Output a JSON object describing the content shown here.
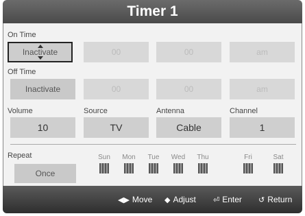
{
  "title": "Timer 1",
  "on_time": {
    "label": "On Time",
    "state": "Inactivate",
    "hour": "00",
    "minute": "00",
    "ampm": "am"
  },
  "off_time": {
    "label": "Off Time",
    "state": "Inactivate",
    "hour": "00",
    "minute": "00",
    "ampm": "am"
  },
  "volume": {
    "label": "Volume",
    "value": "10"
  },
  "source": {
    "label": "Source",
    "value": "TV"
  },
  "antenna": {
    "label": "Antenna",
    "value": "Cable"
  },
  "channel": {
    "label": "Channel",
    "value": "1"
  },
  "repeat": {
    "label": "Repeat",
    "value": "Once",
    "days": [
      "Sun",
      "Mon",
      "Tue",
      "Wed",
      "Thu",
      "Fri",
      "Sat"
    ]
  },
  "footer": {
    "move": "Move",
    "adjust": "Adjust",
    "enter": "Enter",
    "return": "Return"
  }
}
